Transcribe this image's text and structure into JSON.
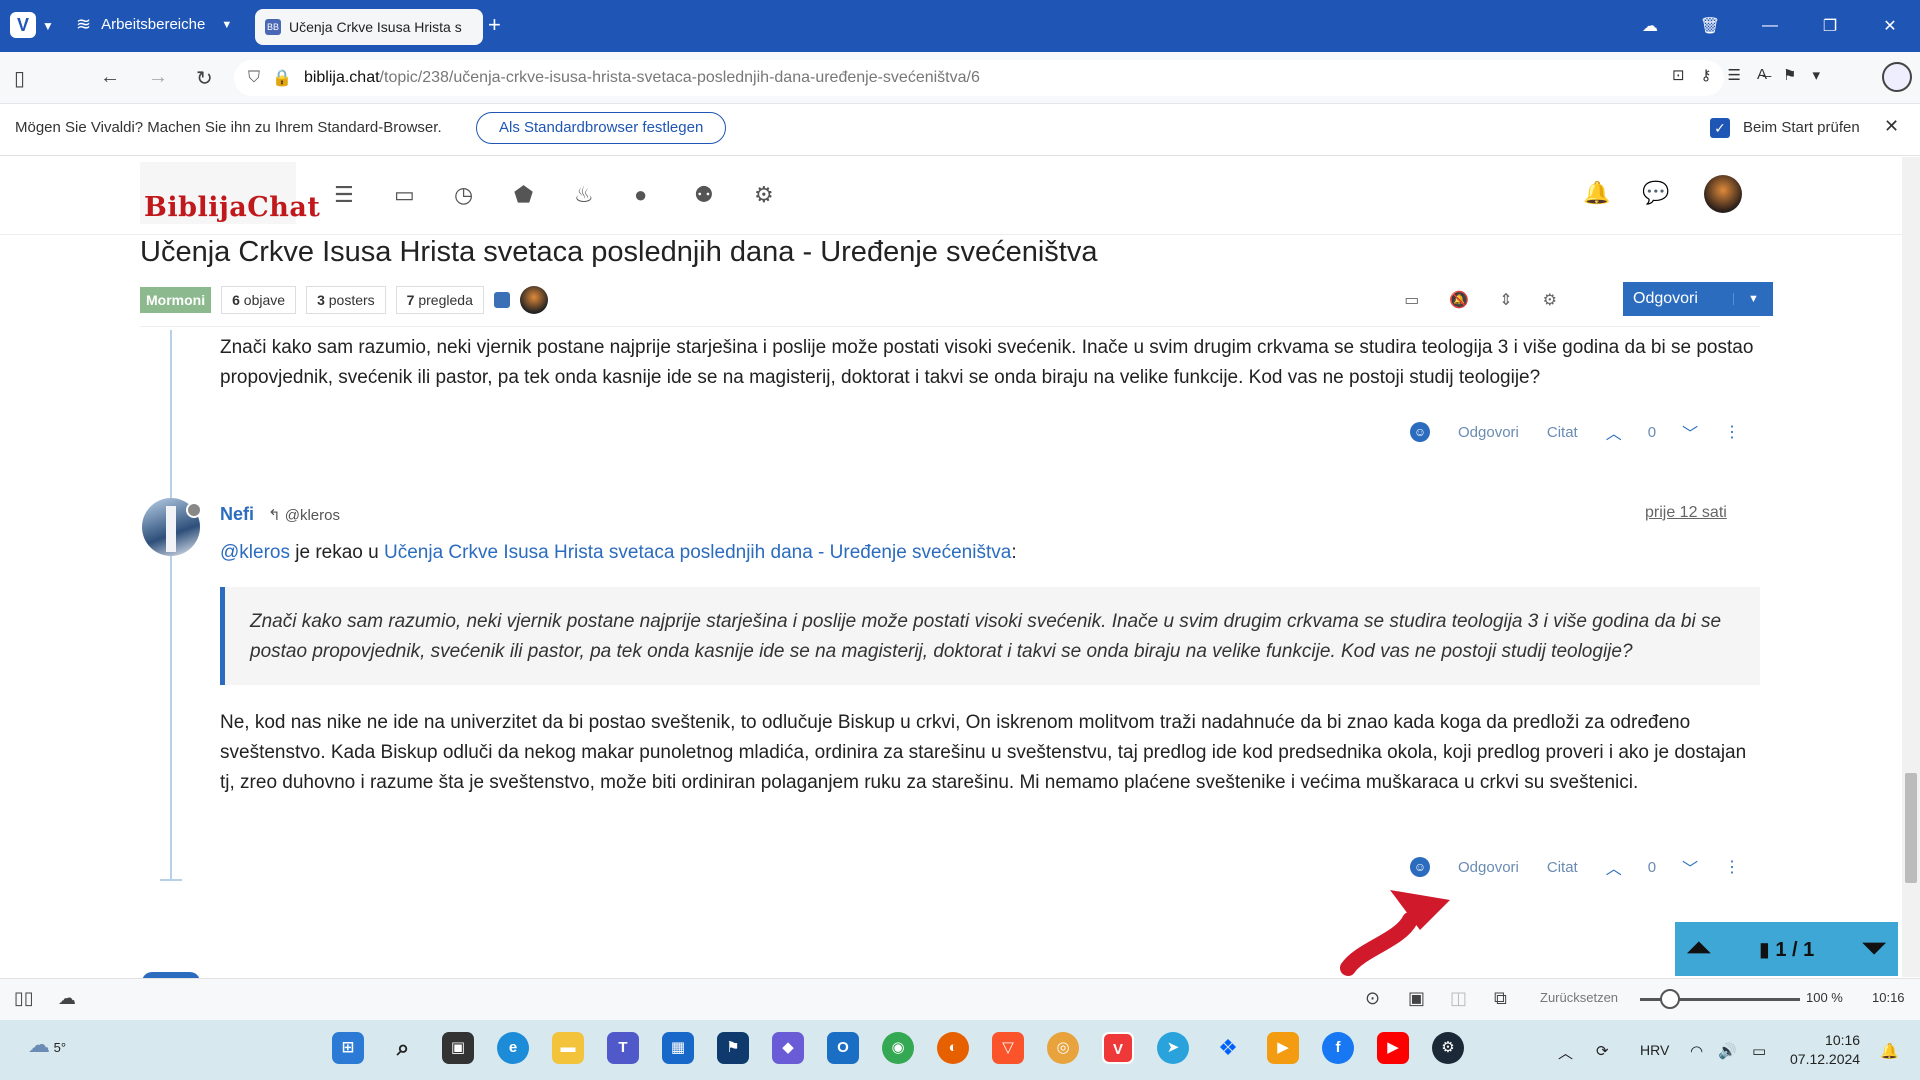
{
  "browser": {
    "workspaces_label": "Arbeitsbereiche",
    "tab_title": "Učenja Crkve Isusa Hrista s",
    "url_host": "biblija.chat",
    "url_path": "/topic/238/učenja-crkve-isusa-hrista-svetaca-poslednjih-dana-uređenje-svećeništva/6",
    "notification_text": "Mögen Sie Vivaldi? Machen Sie ihn zu Ihrem Standard-Browser.",
    "notification_button": "Als Standardbrowser festlegen",
    "notification_checkbox_label": "Beim Start prüfen",
    "notification_checked": true
  },
  "site": {
    "brand": "BiblijaChat"
  },
  "topic": {
    "title": "Učenja Crkve Isusa Hrista svetaca poslednjih dana - Uređenje svećeništva",
    "category": "Mormoni",
    "posts_count": "6",
    "posts_label": "objave",
    "posters_count": "3",
    "posters_label": "posters",
    "views_count": "7",
    "views_label": "pregleda",
    "reply_button": "Odgovori"
  },
  "posts": [
    {
      "body": "Znači kako sam razumio, neki vjernik postane najprije starješina i poslije može postati visoki svećenik. Inače u svim drugim crkvama se studira teologija 3 i više godina da bi se postao propovjednik, svećenik ili pastor, pa tek onda kasnije ide se na magisterij, doktorat i takvi se onda biraju na velike funkcije. Kod vas ne postoji studij teologije?",
      "reply_label": "Odgovori",
      "quote_label": "Citat",
      "votes": "0"
    },
    {
      "author": "Nefi",
      "reply_to": "@kleros",
      "time": "prije 12 sati",
      "quote_user": "@kleros",
      "quote_said": "je rekao u",
      "quote_topic": "Učenja Crkve Isusa Hrista svetaca poslednjih dana - Uređenje svećeništva",
      "quote_colon": ":",
      "quote_text": "Znači kako sam razumio, neki vjernik postane najprije starješina i poslije može postati visoki svećenik. Inače u svim drugim crkvama se studira teologija 3 i više godina da bi se postao propovjednik, svećenik ili pastor, pa tek onda kasnije ide se na magisterij, doktorat i takvi se onda biraju na velike funkcije. Kod vas ne postoji studij teologije?",
      "body": "Ne, kod nas nike ne ide na univerzitet da bi postao sveštenik, to odlučuje Biskup u crkvi, On iskrenom molitvom traži nadahnuće da bi znao kada koga da predloži za određeno sveštenstvo. Kada Biskup odluči da nekog makar punoletnog mladića, ordinira za starešinu u sveštenstvu, taj predlog ide kod predsednika okola, koji predlog proveri i ako je dostajan tj, zreo duhovno i razume šta je sveštenstvo, može biti ordiniran polaganjem ruku za starešinu. Mi nemamo plaćene sveštenike i većima muškaraca u crkvi su sveštenici.",
      "reply_label": "Odgovori",
      "quote_label": "Citat",
      "votes": "0"
    }
  ],
  "paginator": "1 / 1",
  "statusbar": {
    "reset_label": "Zurücksetzen",
    "zoom": "100 %",
    "time": "10:16"
  },
  "taskbar": {
    "weather": "5°",
    "language": "HRV",
    "time": "10:16",
    "date": "07.12.2024"
  },
  "colors": {
    "browser_accent": "#1f55b5",
    "link": "#2b6cbf",
    "category": "#8db98e",
    "annotation_arrow": "#d0192b"
  }
}
